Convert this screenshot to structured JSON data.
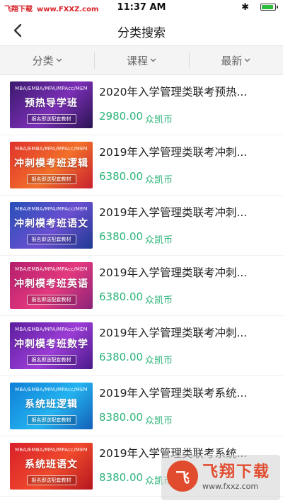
{
  "status_bar": {
    "carrier": "飞翔下载",
    "site": "www.FXXZ.com",
    "time": "11:37 AM",
    "battery_level": 0.9,
    "battery_color": "#2bbd3b"
  },
  "nav": {
    "title": "分类搜索",
    "back_icon": "chevron-left-icon"
  },
  "filters": [
    {
      "label": "分类"
    },
    {
      "label": "课程"
    },
    {
      "label": "最新"
    }
  ],
  "currency_label": "众凯币",
  "price_color": "#2cb37a",
  "courses": [
    {
      "title": "2020年入学管理类联考预热...",
      "price": "2980.00",
      "thumb": {
        "top": "MBA/EMBA/MPA/MPAcc/MEM",
        "main": "预热导学班",
        "sub": "报名即送配套教材",
        "bg": "linear-gradient(135deg,#3b1a6e,#7b2fb6 55%,#2a1452)"
      }
    },
    {
      "title": "2019年入学管理类联考冲刺...",
      "price": "6380.00",
      "thumb": {
        "top": "MBA/EMBA/MPA/MPAcc/MEM",
        "main": "冲刺模考班逻辑",
        "sub": "报名即送配套教材",
        "bg": "linear-gradient(135deg,#e0322d,#f2702a 55%,#c8202e)"
      }
    },
    {
      "title": "2019年入学管理类联考冲刺...",
      "price": "6380.00",
      "thumb": {
        "top": "MBA/EMBA/MPA/MPAcc/MEM",
        "main": "冲刺模考班语文",
        "sub": "报名即送配套教材",
        "bg": "linear-gradient(135deg,#2750b8,#6a4fd0 55%,#1f3a92)"
      }
    },
    {
      "title": "2019年入学管理类联考冲刺...",
      "price": "6380.00",
      "thumb": {
        "top": "MBA/EMBA/MPA/MPAcc/MEM",
        "main": "冲刺模考班英语",
        "sub": "报名即送配套教材",
        "bg": "linear-gradient(135deg,#b41e6c,#e4397f 55%,#8a2378)"
      }
    },
    {
      "title": "2019年入学管理类联考冲刺...",
      "price": "6380.00",
      "thumb": {
        "top": "MBA/EMBA/MPA/MPAcc/MEM",
        "main": "冲刺模考班数学",
        "sub": "报名即送配套教材",
        "bg": "linear-gradient(135deg,#5c1e9e,#9b3dd6 55%,#4a1a8a)"
      }
    },
    {
      "title": "2019年入学管理类联考系统...",
      "price": "8380.00",
      "thumb": {
        "top": "MBA/EMBA/MPA/MPAcc/MEM",
        "main": "系统班逻辑",
        "sub": "报名即送配套教材",
        "bg": "linear-gradient(135deg,#0f7fd6,#24b3f0 55%,#1360b8)"
      }
    },
    {
      "title": "2019年入学管理类联考系统...",
      "price": "8380.00",
      "thumb": {
        "top": "MBA/EMBA/MPA/MPAcc/MEM",
        "main": "系统班语文",
        "sub": "报名即送配套教材",
        "bg": "linear-gradient(135deg,#d81f2a,#f04a2c 55%,#b5161f)"
      }
    }
  ],
  "watermark": {
    "logo_char": "飞",
    "text": "飞翔下载",
    "url": "www.fxxz.com"
  }
}
